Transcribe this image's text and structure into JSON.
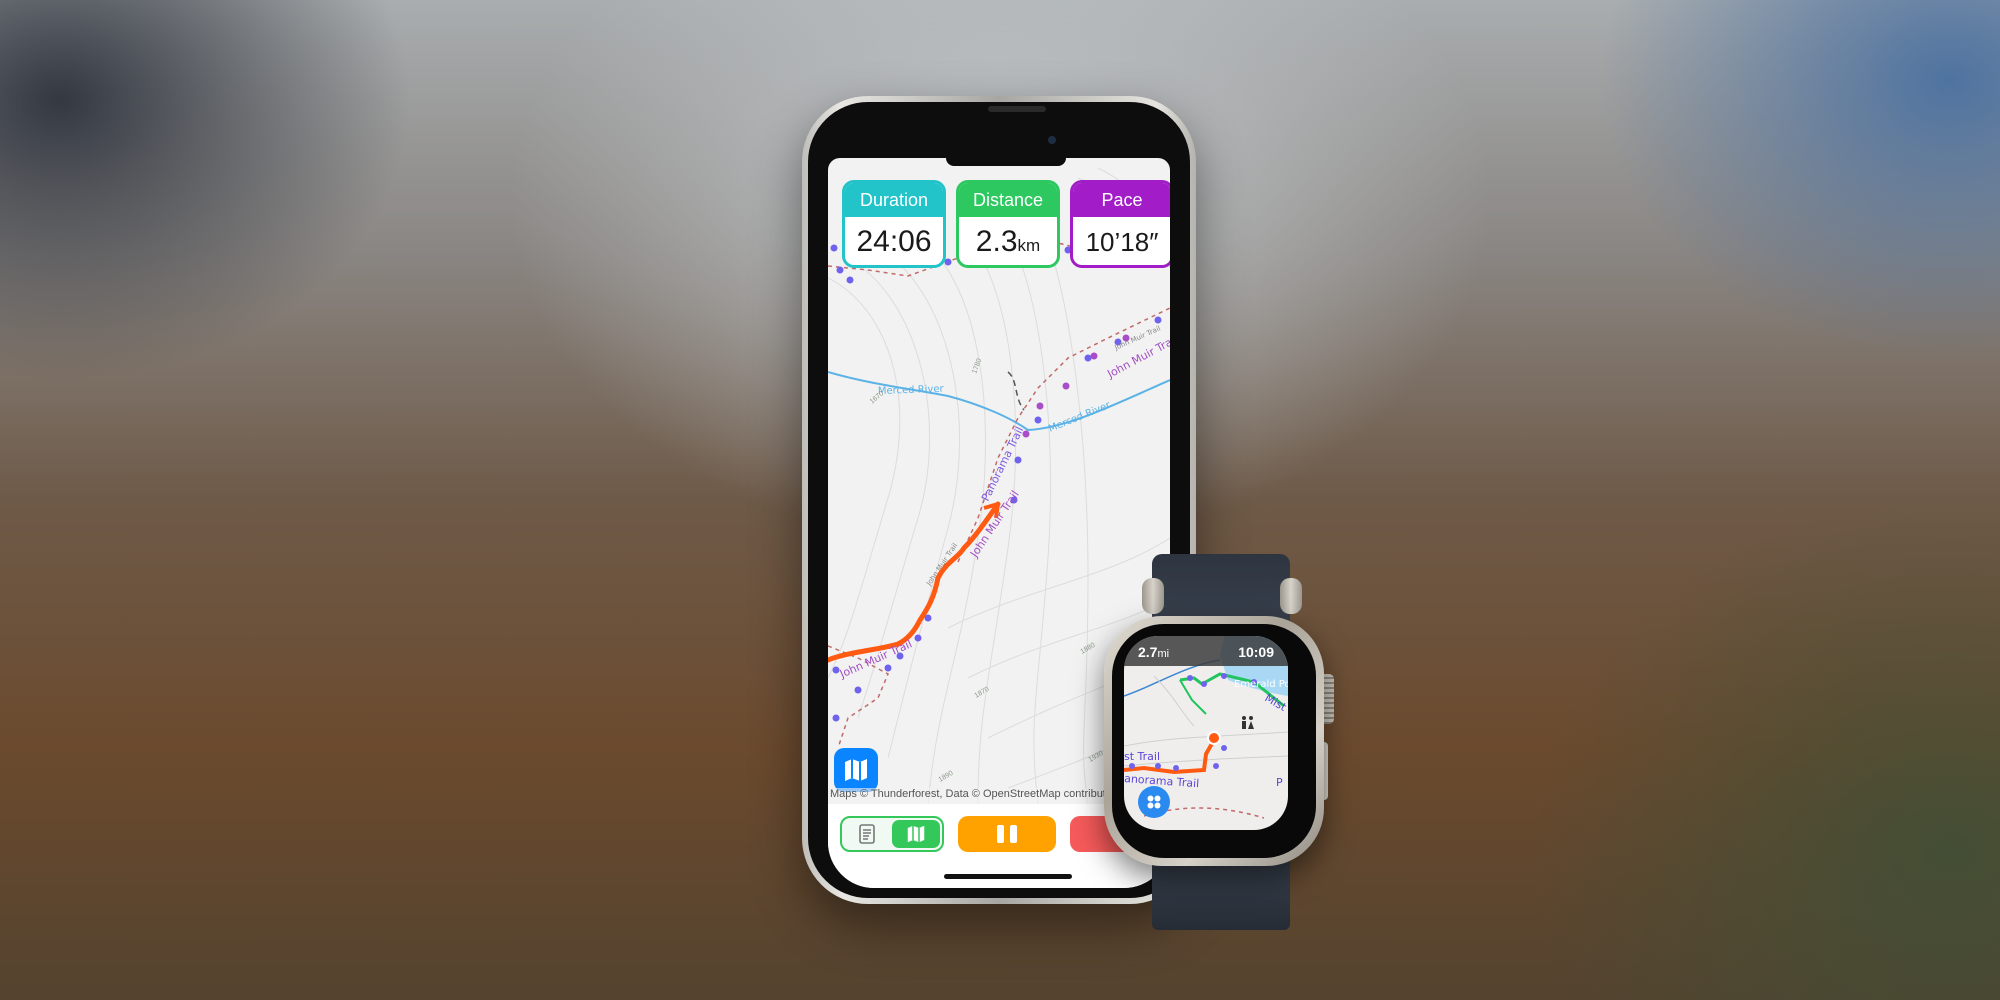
{
  "phone": {
    "stats": [
      {
        "label": "Duration",
        "value": "24:06",
        "unit": "",
        "color": "#22c3c9"
      },
      {
        "label": "Distance",
        "value": "2.3",
        "unit": "km",
        "color": "#2dc860"
      },
      {
        "label": "Pace",
        "value": "10’18″",
        "unit": "",
        "color": "#a21dc7"
      }
    ],
    "map": {
      "labels": {
        "river1": "Merced River",
        "river2": "Merced River",
        "trail_panorama": "Panorama Trail",
        "trail_jmt1": "John Muir Trail",
        "trail_jmt2": "John Muir Trail",
        "trail_jmt3": "John Muir Trail",
        "trail_jmt_small1": "John Muir Trail",
        "trail_jmt_small2": "John Muir Trail",
        "trail_mist": "Mist Trail"
      },
      "contours": [
        "1780",
        "1670",
        "1880",
        "1870",
        "1890",
        "1930"
      ],
      "attribution": "Maps © Thunderforest, Data © OpenStreetMap contributors",
      "track_color": "#ff5a12",
      "trail_color": "#7b6cf0"
    },
    "toolbar": {
      "view_toggle": {
        "options": [
          "list",
          "map"
        ],
        "selected": "map"
      },
      "pause_label": "pause",
      "stop_label": "stop"
    }
  },
  "watch": {
    "distance": "2.7",
    "distance_unit": "mi",
    "time": "10:09",
    "labels": {
      "pool": "Emerald Pool",
      "mist": "Mist",
      "trail_left": "st Trail",
      "panorama": "anorama Trail",
      "p": "P"
    }
  }
}
